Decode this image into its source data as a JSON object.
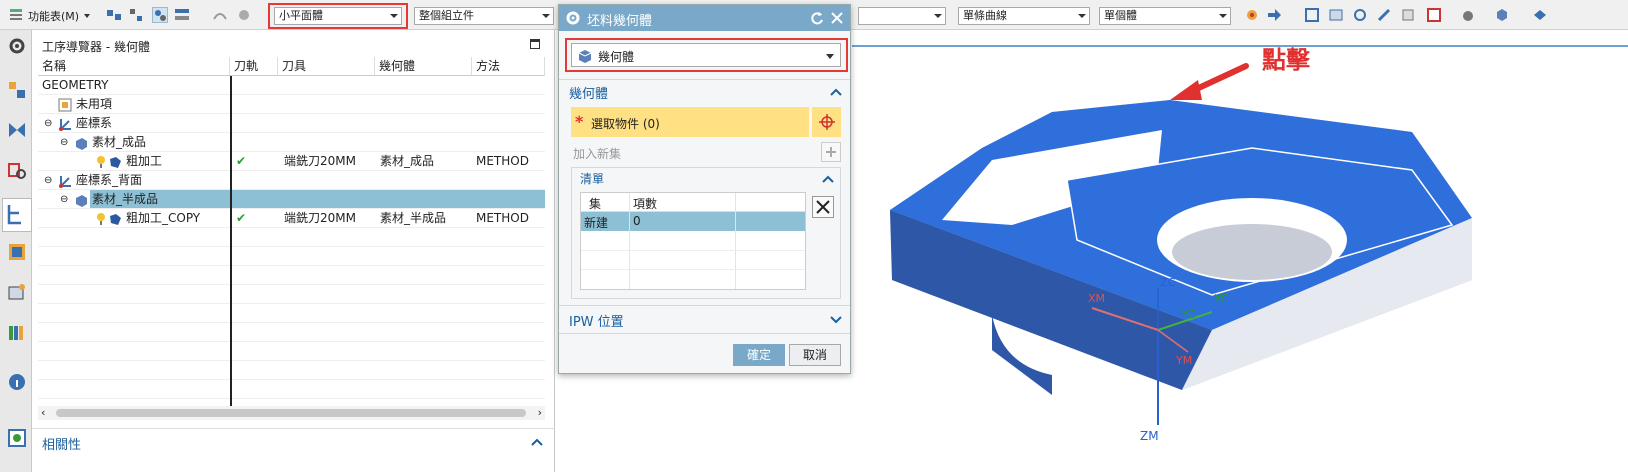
{
  "toolbar": {
    "menu_label": "功能表(M)",
    "combo1": "小平面體",
    "combo2": "整個組立件",
    "combo3": "單條曲線",
    "combo4": "單個體"
  },
  "navigator": {
    "title": "工序導覽器 - 幾何體",
    "columns": [
      "名稱",
      "刀軌",
      "刀具",
      "幾何體",
      "方法"
    ],
    "rows": [
      {
        "name": "GEOMETRY",
        "path": "",
        "tool": "",
        "geom": "",
        "method": ""
      },
      {
        "name": "未用項",
        "path": "",
        "tool": "",
        "geom": "",
        "method": ""
      },
      {
        "name": "座標系",
        "path": "",
        "tool": "",
        "geom": "",
        "method": ""
      },
      {
        "name": "素材_成品",
        "path": "",
        "tool": "",
        "geom": "",
        "method": ""
      },
      {
        "name": "粗加工",
        "path": "✔",
        "tool": "端銑刀20MM",
        "geom": "素材_成品",
        "method": "METHOD"
      },
      {
        "name": "座標系_背面",
        "path": "",
        "tool": "",
        "geom": "",
        "method": ""
      },
      {
        "name": "素材_半成品",
        "path": "",
        "tool": "",
        "geom": "",
        "method": ""
      },
      {
        "name": "粗加工_COPY",
        "path": "✔",
        "tool": "端銑刀20MM",
        "geom": "素材_半成品",
        "method": "METHOD"
      }
    ],
    "related": "相關性"
  },
  "dialog": {
    "title": "坯料幾何體",
    "type_value": "幾何體",
    "section_geometry": "幾何體",
    "select_label": "選取物件 (0)",
    "add_new_set": "加入新集",
    "list_title": "清單",
    "list_headers": [
      "集",
      "項數"
    ],
    "list_rows": [
      {
        "set": "新建",
        "count": "0"
      }
    ],
    "section_ipw": "IPW 位置",
    "ok": "確定",
    "cancel": "取消"
  },
  "viewport": {
    "annotation": "點擊",
    "axes": {
      "xc": "XC",
      "yc": "YC",
      "zc": "ZC",
      "xm": "XM",
      "ym": "YM",
      "zm": "ZM"
    }
  },
  "colors": {
    "accent": "#7aa8c8",
    "highlight": "#e53935",
    "selected_row": "#8dc0d4",
    "model_blue": "#2f6fdc",
    "select_bar": "#ffe082"
  }
}
